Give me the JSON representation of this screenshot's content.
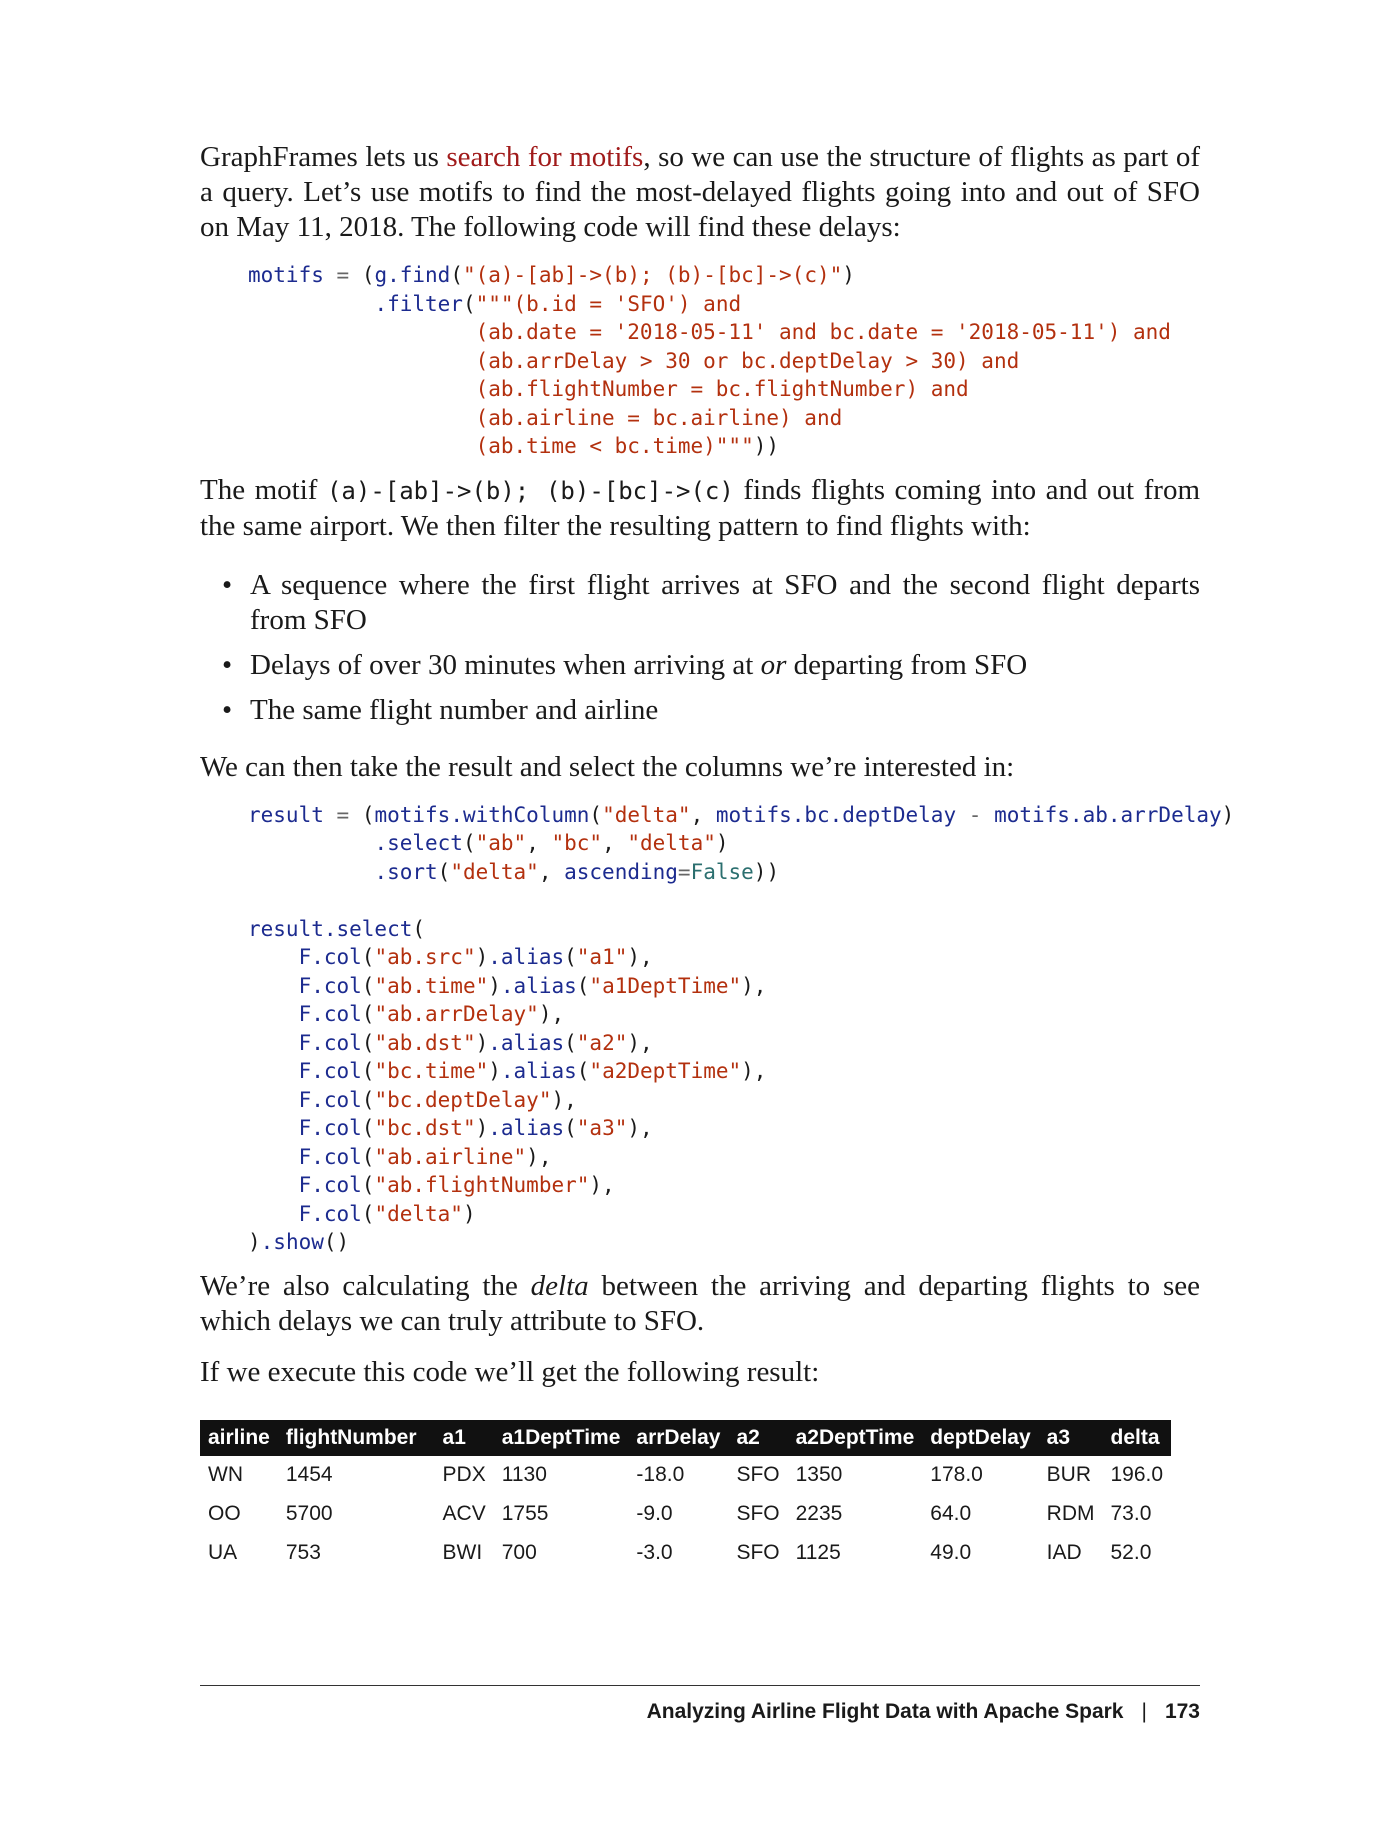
{
  "para1": {
    "pre": "GraphFrames lets us ",
    "link": "search for motifs",
    "post": ", so we can use the structure of flights as part of a query. Let’s use motifs to find the most-delayed flights going into and out of SFO on May 11, 2018. The following code will find these delays:"
  },
  "code1": [
    "motifs = (g.find(\"(a)-[ab]->(b); (b)-[bc]->(c)\")",
    "          .filter(\"\"\"(b.id = 'SFO') and",
    "                  (ab.date = '2018-05-11' and bc.date = '2018-05-11') and",
    "                  (ab.arrDelay > 30 or bc.deptDelay > 30) and",
    "                  (ab.flightNumber = bc.flightNumber) and",
    "                  (ab.airline = bc.airline) and",
    "                  (ab.time < bc.time)\"\"\"))"
  ],
  "para2": {
    "pre": "The motif ",
    "code": "(a)-[ab]->(b); (b)-[bc]->(c)",
    "post": " finds flights coming into and out from the same airport. We then filter the resulting pattern to find flights with:"
  },
  "bullets": {
    "b1": "A sequence where the first flight arrives at SFO and the second flight departs from SFO",
    "b2_pre": "Delays of over 30 minutes when arriving at ",
    "b2_em": "or",
    "b2_post": " departing from SFO",
    "b3": "The same flight number and airline"
  },
  "para3": "We can then take the result and select the columns we’re interested in:",
  "code2": [
    "result = (motifs.withColumn(\"delta\", motifs.bc.deptDelay - motifs.ab.arrDelay)",
    "          .select(\"ab\", \"bc\", \"delta\")",
    "          .sort(\"delta\", ascending=False))",
    "",
    "result.select(",
    "    F.col(\"ab.src\").alias(\"a1\"),",
    "    F.col(\"ab.time\").alias(\"a1DeptTime\"),",
    "    F.col(\"ab.arrDelay\"),",
    "    F.col(\"ab.dst\").alias(\"a2\"),",
    "    F.col(\"bc.time\").alias(\"a2DeptTime\"),",
    "    F.col(\"bc.deptDelay\"),",
    "    F.col(\"bc.dst\").alias(\"a3\"),",
    "    F.col(\"ab.airline\"),",
    "    F.col(\"ab.flightNumber\"),",
    "    F.col(\"delta\")",
    ").show()"
  ],
  "para4": {
    "pre": "We’re also calculating the ",
    "em": "delta",
    "post": " between the arriving and departing flights to see which delays we can truly attribute to SFO."
  },
  "para5": "If we execute this code we’ll get the following result:",
  "table": {
    "headers": [
      "airline",
      "flightNumber",
      "a1",
      "a1DeptTime",
      "arrDelay",
      "a2",
      "a2DeptTime",
      "deptDelay",
      "a3",
      "delta"
    ],
    "rows": [
      [
        "WN",
        "1454",
        "PDX",
        "1130",
        "-18.0",
        "SFO",
        "1350",
        "178.0",
        "BUR",
        "196.0"
      ],
      [
        "OO",
        "5700",
        "ACV",
        "1755",
        "-9.0",
        "SFO",
        "2235",
        "64.0",
        "RDM",
        "73.0"
      ],
      [
        "UA",
        "753",
        "BWI",
        "700",
        "-3.0",
        "SFO",
        "1125",
        "49.0",
        "IAD",
        "52.0"
      ]
    ]
  },
  "footer": {
    "title": "Analyzing Airline Flight Data with Apache Spark",
    "separator": "|",
    "page": "173"
  }
}
